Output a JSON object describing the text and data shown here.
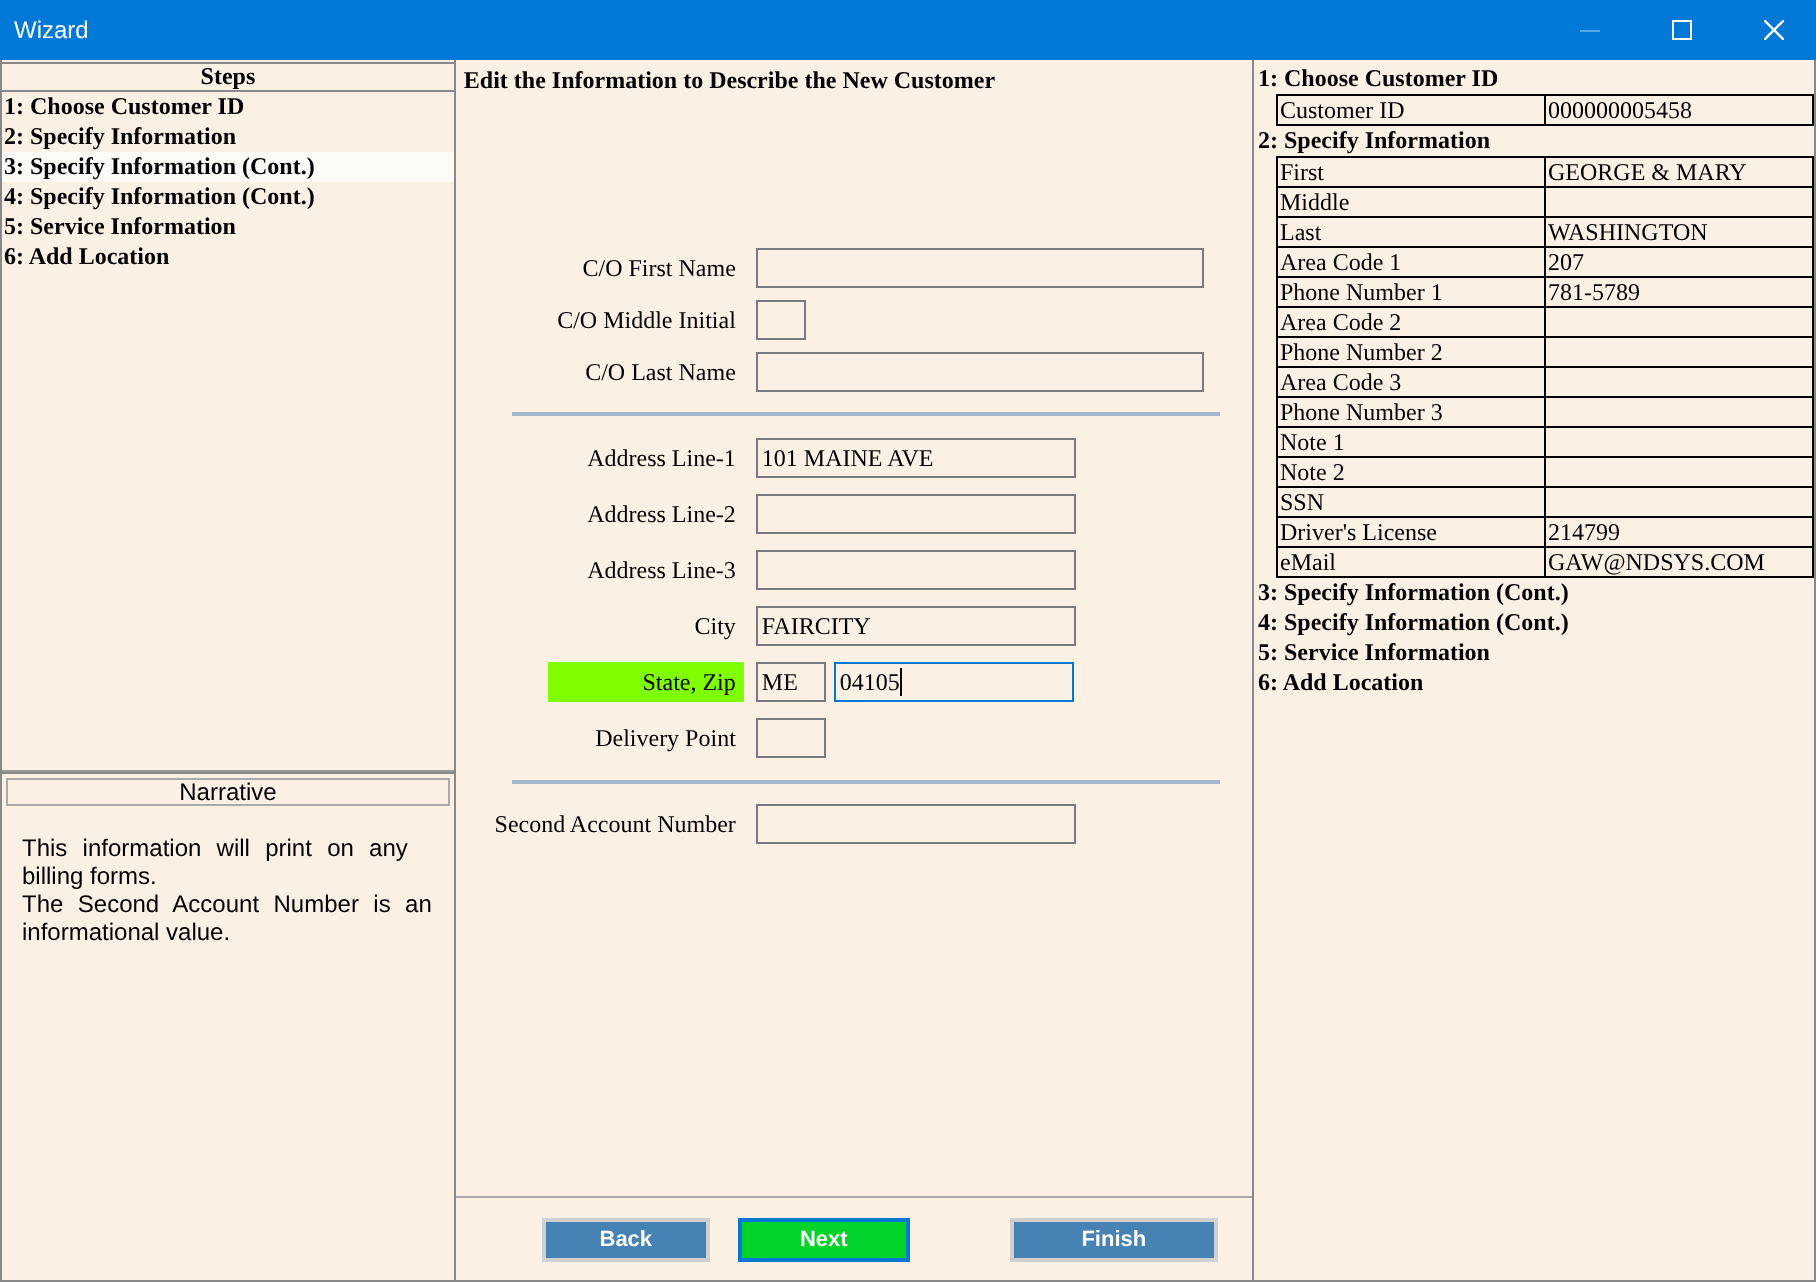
{
  "window": {
    "title": "Wizard",
    "minimize_disabled": true
  },
  "steps": {
    "title": "Steps",
    "items": [
      {
        "label": "1: Choose Customer ID",
        "selected": false
      },
      {
        "label": "2: Specify Information",
        "selected": false
      },
      {
        "label": "3: Specify Information (Cont.)",
        "selected": true
      },
      {
        "label": "4: Specify Information (Cont.)",
        "selected": false
      },
      {
        "label": "5: Service Information",
        "selected": false
      },
      {
        "label": "6: Add Location",
        "selected": false
      }
    ]
  },
  "narrative": {
    "title": "Narrative",
    "lines": [
      "This information will print on any billing forms.",
      "The Second Account Number is an informational value."
    ]
  },
  "form": {
    "title": "Edit the Information to Describe the New Customer",
    "groups": [
      {
        "rows": [
          {
            "label": "C/O First Name",
            "highlighted": false,
            "fields": [
              {
                "kind": "wide",
                "focused": false
              }
            ]
          },
          {
            "label": "C/O Middle Initial",
            "highlighted": false,
            "fields": [
              {
                "kind": "tiny",
                "focused": false
              }
            ]
          },
          {
            "label": "C/O Last Name",
            "highlighted": false,
            "fields": [
              {
                "kind": "wide",
                "focused": false
              }
            ]
          }
        ]
      },
      {
        "rows": [
          {
            "label": "Address Line-1",
            "highlighted": false,
            "fields": [
              {
                "kind": "medium",
                "value": "101 MAINE AVE",
                "focused": false
              }
            ]
          },
          {
            "label": "Address Line-2",
            "highlighted": false,
            "fields": [
              {
                "kind": "medium",
                "focused": false
              }
            ]
          },
          {
            "label": "Address Line-3",
            "highlighted": false,
            "fields": [
              {
                "kind": "medium",
                "focused": false
              }
            ]
          },
          {
            "label": "City",
            "highlighted": false,
            "fields": [
              {
                "kind": "medium",
                "value": "FAIRCITY",
                "focused": false
              }
            ]
          },
          {
            "label": "State, Zip",
            "highlighted": true,
            "fields": [
              {
                "kind": "small",
                "value": "ME",
                "focused": false
              },
              {
                "kind": "zip",
                "value": "04105",
                "focused": true
              }
            ]
          },
          {
            "label": "Delivery Point",
            "highlighted": false,
            "fields": [
              {
                "kind": "small",
                "focused": false
              }
            ]
          }
        ]
      },
      {
        "rows": [
          {
            "label": "Second Account Number",
            "highlighted": false,
            "fields": [
              {
                "kind": "medium",
                "focused": false
              }
            ]
          }
        ]
      }
    ]
  },
  "buttons": [
    {
      "label": "Back",
      "default": false
    },
    {
      "label": "Next",
      "default": true
    },
    {
      "label": "Finish",
      "default": false
    }
  ],
  "summary": {
    "sections": [
      {
        "title": "1: Choose Customer ID",
        "rows": [
          {
            "label": "Customer  ID",
            "value": "000000005458"
          }
        ]
      },
      {
        "title": "2: Specify Information",
        "rows": [
          {
            "label": "First",
            "value": "GEORGE & MARY"
          },
          {
            "label": "Middle"
          },
          {
            "label": "Last",
            "value": "WASHINGTON"
          },
          {
            "label": "Area Code 1",
            "value": "207"
          },
          {
            "label": "Phone Number 1",
            "value": "781-5789"
          },
          {
            "label": "Area Code 2"
          },
          {
            "label": "Phone Number 2"
          },
          {
            "label": "Area Code 3"
          },
          {
            "label": "Phone Number 3"
          },
          {
            "label": "Note 1"
          },
          {
            "label": "Note 2"
          },
          {
            "label": "SSN"
          },
          {
            "label": "Driver's License",
            "value": "214799"
          },
          {
            "label": "eMail",
            "value": "GAW@NDSYS.COM"
          }
        ]
      },
      {
        "title": "3: Specify Information (Cont.)"
      },
      {
        "title": "4: Specify Information (Cont.)"
      },
      {
        "title": "5: Service Information"
      },
      {
        "title": "6: Add Location"
      }
    ]
  }
}
